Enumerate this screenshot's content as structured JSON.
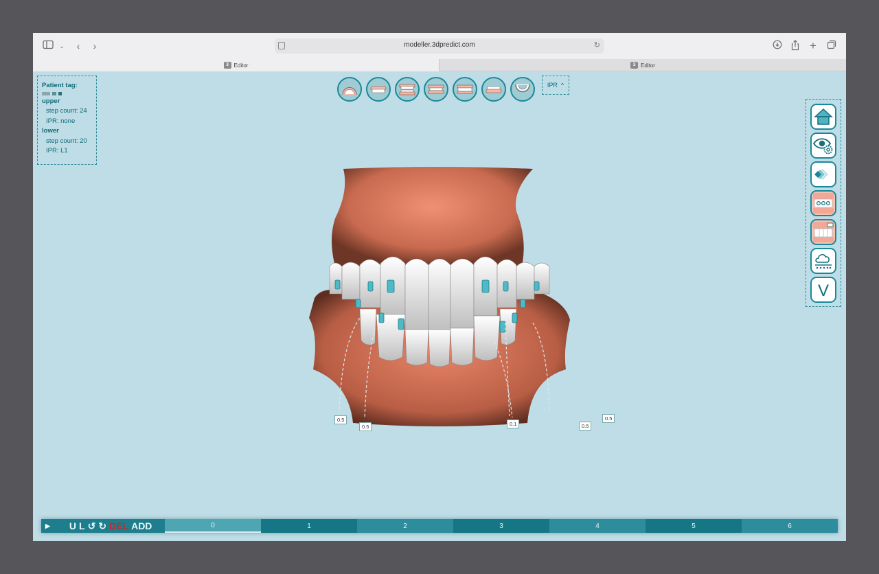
{
  "browser": {
    "url": "modeller.3dpredict.com",
    "tabs": [
      {
        "badge": "3",
        "label": "Editor"
      },
      {
        "badge": "3",
        "label": "Editor"
      }
    ]
  },
  "info_panel": {
    "patient_tag_label": "Patient tag:",
    "upper": {
      "title": "upper",
      "step_count": "step count: 24",
      "ipr": "IPR: none"
    },
    "lower": {
      "title": "lower",
      "step_count": "step count: 20",
      "ipr": "IPR: L1"
    }
  },
  "ipr_toggle": {
    "label": "IPR",
    "arrow": "^"
  },
  "view_buttons": [
    "upper-occlusal-view-icon",
    "upper-front-view-icon",
    "front-open-view-icon",
    "front-closed-view-icon",
    "right-view-icon",
    "lower-front-view-icon",
    "lower-occlusal-view-icon"
  ],
  "right_tools": [
    "home-icon",
    "visibility-settings-icon",
    "stages-icon",
    "attachments-icon",
    "ipr-tool-icon",
    "cloud-upload-icon",
    "version-icon"
  ],
  "right_tools_version_letter": "V",
  "ipr_labels": [
    "0.5",
    "0.5",
    "0.1",
    "0.5",
    "0.5"
  ],
  "timeline": {
    "play": "▶",
    "controls": {
      "u": "U",
      "l": "L",
      "undo": "↺",
      "redo": "↻",
      "del": "DEL",
      "add": "ADD"
    },
    "steps": [
      "0",
      "1",
      "2",
      "3",
      "4",
      "5",
      "6"
    ],
    "current_step": 0
  }
}
